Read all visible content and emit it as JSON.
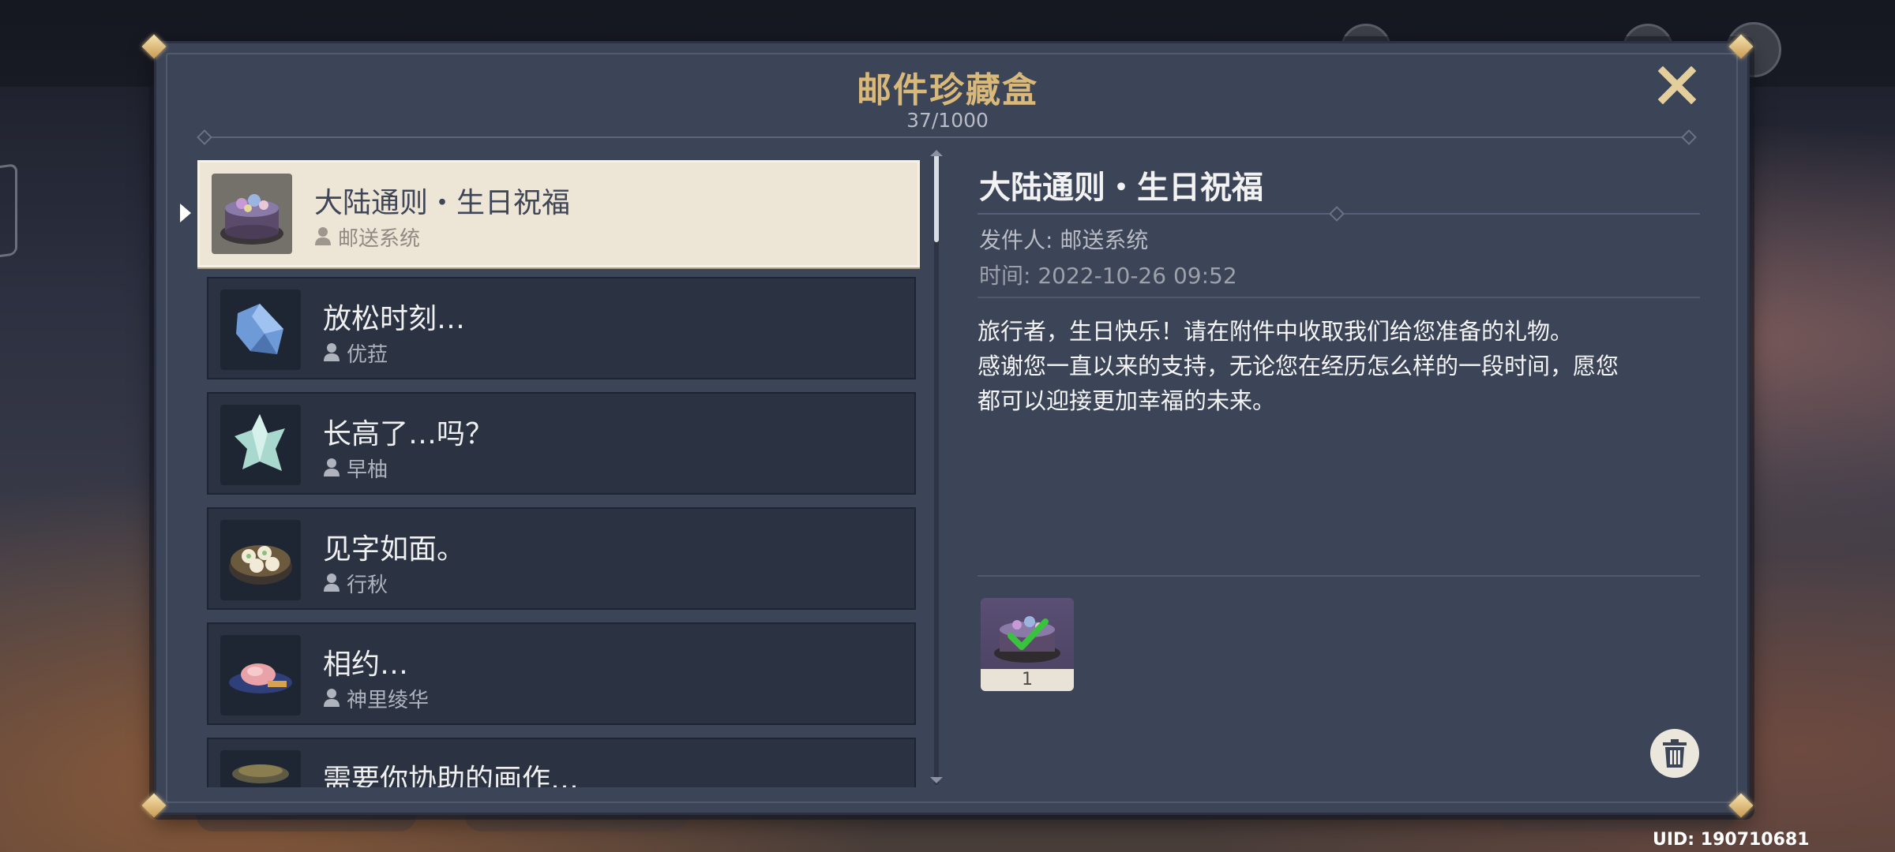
{
  "header": {
    "title": "邮件珍藏盒",
    "count": "37/1000"
  },
  "mails": [
    {
      "title": "大陆通则・生日祝福",
      "sender": "邮送系统",
      "icon": "birthday-cake-icon",
      "selected": true
    },
    {
      "title": "放松时刻…",
      "sender": "优菈",
      "icon": "crystal-chunk-icon",
      "selected": false
    },
    {
      "title": "长高了…吗？",
      "sender": "早柚",
      "icon": "crystal-shard-icon",
      "selected": false
    },
    {
      "title": "见字如面。",
      "sender": "行秋",
      "icon": "dumpling-steamer-icon",
      "selected": false
    },
    {
      "title": "相约…",
      "sender": "神里绫华",
      "icon": "sakura-dish-icon",
      "selected": false
    },
    {
      "title": "需要你协助的画作…",
      "sender": "",
      "icon": "food-plate-icon",
      "selected": false
    }
  ],
  "detail": {
    "title": "大陆通则・生日祝福",
    "sender": "发件人: 邮送系统",
    "time": "时间: 2022-10-26 09:52",
    "body": "旅行者，生日快乐！请在附件中收取我们给您准备的礼物。\n感谢您一直以来的支持，无论您在经历怎么样的一段时间，愿您\n都可以迎接更加幸福的未来。",
    "attachment": {
      "icon": "birthday-cake-icon",
      "count": "1",
      "claimed": true
    }
  },
  "uid": "UID: 190710681",
  "colors": {
    "title_gold": "#d9b97a",
    "panel_bg": "#3c4457",
    "selected_item_bg": "#ede5d6",
    "item_bg": "#2b3343",
    "claimed_check": "#39c23d"
  }
}
